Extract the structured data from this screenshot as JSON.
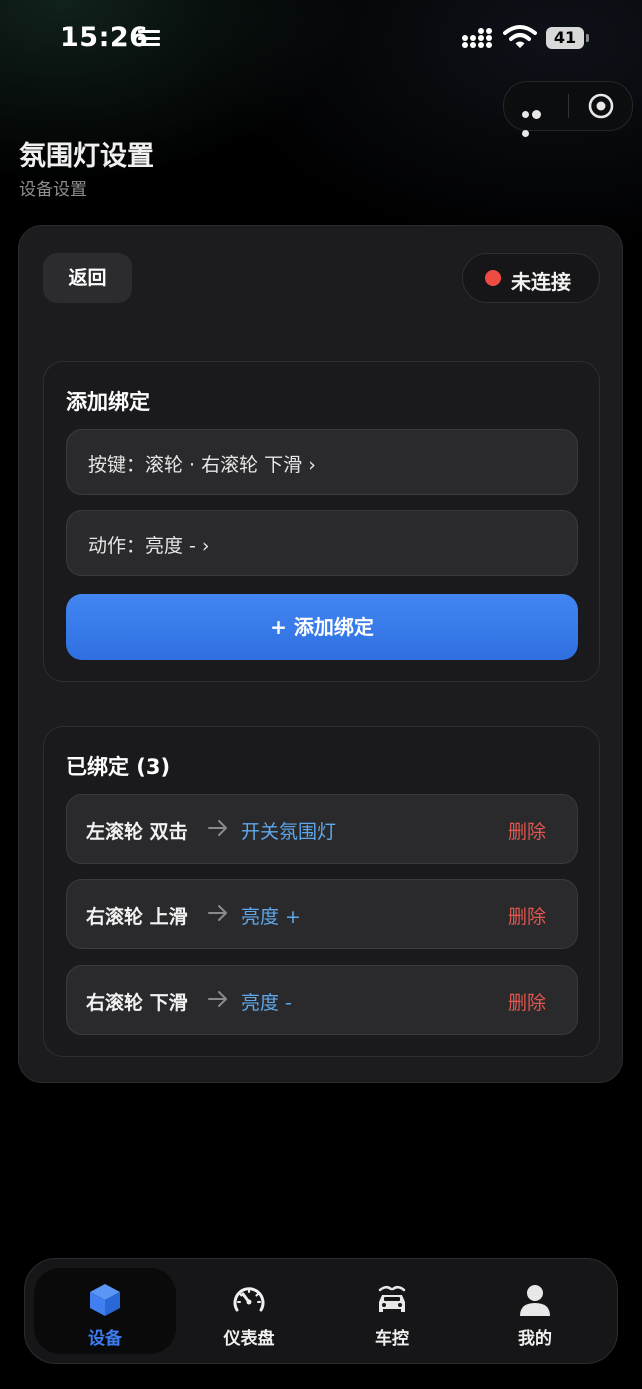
{
  "status_bar": {
    "time": "15:26",
    "battery": "41"
  },
  "header": {
    "title": "氛围灯设置",
    "subtitle": "设备设置"
  },
  "toolbar": {
    "back_label": "返回",
    "connection_status": "未连接",
    "status_color": "#ef4b43"
  },
  "add_binding": {
    "title": "添加绑定",
    "key_picker": "按键：滚轮 · 右滚轮 下滑 ›",
    "action_picker": "动作：亮度 - ›",
    "submit_label": "+ 添加绑定",
    "accent_color": "#3a7cee"
  },
  "bound": {
    "title": "已绑定 (3)",
    "delete_label": "删除",
    "items": [
      {
        "key": "左滚轮 双击",
        "action": "开关氛围灯"
      },
      {
        "key": "右滚轮 上滑",
        "action": "亮度 +"
      },
      {
        "key": "右滚轮 下滑",
        "action": "亮度 -"
      }
    ]
  },
  "tabs": [
    {
      "label": "设备",
      "icon": "cube-icon",
      "active": true
    },
    {
      "label": "仪表盘",
      "icon": "speedometer-icon",
      "active": false
    },
    {
      "label": "车控",
      "icon": "car-icon",
      "active": false
    },
    {
      "label": "我的",
      "icon": "user-icon",
      "active": false
    }
  ]
}
